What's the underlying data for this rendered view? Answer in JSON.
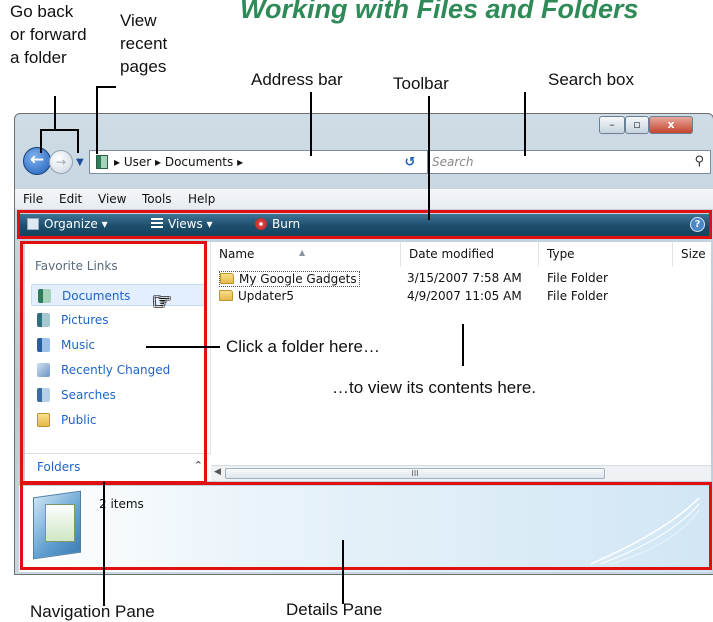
{
  "page_title": "Working with Files and Folders",
  "callouts": {
    "go_back_forward": [
      "Go back",
      "or forward",
      "a folder"
    ],
    "view_recent": [
      "View",
      "recent",
      "pages"
    ],
    "address_bar": "Address bar",
    "toolbar": "Toolbar",
    "search_box": "Search box",
    "click_folder": "Click a folder here…",
    "view_contents": "…to view its contents here.",
    "navigation_pane": "Navigation Pane",
    "details_pane": "Details Pane"
  },
  "window": {
    "controls": {
      "minimize": "–",
      "maximize": "▫",
      "close": "x"
    },
    "address": {
      "path": "▸ User ▸ Documents ▸"
    },
    "search": {
      "placeholder": "Search"
    },
    "menu": [
      "File",
      "Edit",
      "View",
      "Tools",
      "Help"
    ],
    "toolbar": {
      "organize": "Organize ▾",
      "views": "Views ▾",
      "burn": "Burn"
    },
    "nav_pane": {
      "heading": "Favorite Links",
      "items": [
        {
          "label": "Documents",
          "icon": "documents-icon"
        },
        {
          "label": "Pictures",
          "icon": "pictures-icon"
        },
        {
          "label": "Music",
          "icon": "music-icon"
        },
        {
          "label": "Recently Changed",
          "icon": "recently-changed-icon"
        },
        {
          "label": "Searches",
          "icon": "searches-icon"
        },
        {
          "label": "Public",
          "icon": "public-folder-icon"
        }
      ],
      "folders_label": "Folders"
    },
    "columns": [
      "Name",
      "Date modified",
      "Type",
      "Size"
    ],
    "rows": [
      {
        "name": "My Google Gadgets",
        "date": "3/15/2007 7:58 AM",
        "type": "File Folder"
      },
      {
        "name": "Updater5",
        "date": "4/9/2007 11:05 AM",
        "type": "File Folder"
      }
    ],
    "scroll_thumb": "III",
    "details": {
      "count": "2 items"
    }
  },
  "colors": {
    "annotation_box": "#e01010",
    "title": "#2e8b57",
    "link": "#1e64c8",
    "toolbar": "#1c4e6c"
  }
}
